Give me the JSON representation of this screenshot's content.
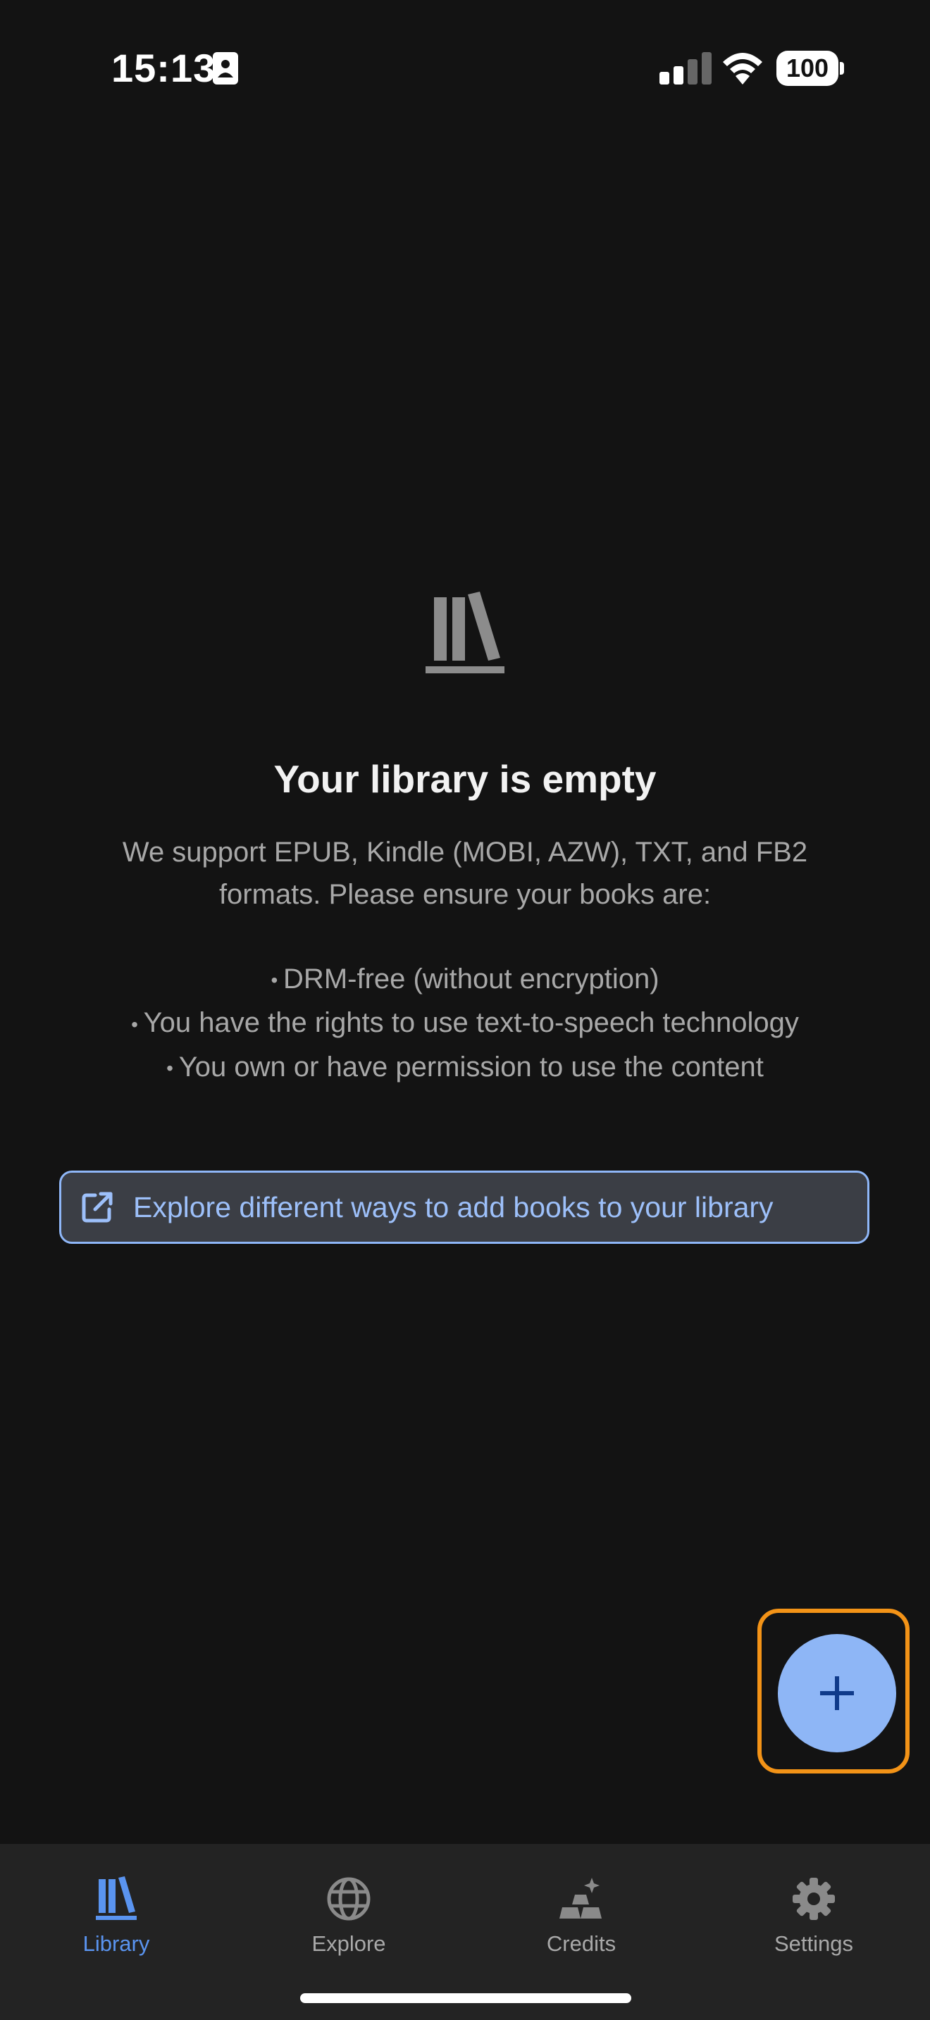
{
  "status_bar": {
    "time": "15:13",
    "battery": "100"
  },
  "empty_state": {
    "icon": "books-icon",
    "title": "Your library is empty",
    "description": "We support EPUB, Kindle (MOBI, AZW), TXT, and FB2 formats. Please ensure your books are:",
    "requirements": [
      "DRM-free (without encryption)",
      "You have the rights to use text-to-speech technology",
      "You own or have permission to use the content"
    ]
  },
  "explore_link": {
    "label": "Explore different ways to add books to your library",
    "icon": "external-link-icon"
  },
  "fab": {
    "icon": "plus-icon"
  },
  "tabs": [
    {
      "label": "Library",
      "icon": "library-icon",
      "active": true
    },
    {
      "label": "Explore",
      "icon": "globe-icon",
      "active": false
    },
    {
      "label": "Credits",
      "icon": "credits-icon",
      "active": false
    },
    {
      "label": "Settings",
      "icon": "gear-icon",
      "active": false
    }
  ],
  "colors": {
    "background": "#131313",
    "accent": "#5a94f0",
    "link": "#9dc0fa",
    "fab": "#8eb6f6",
    "highlight": "#f39317"
  }
}
